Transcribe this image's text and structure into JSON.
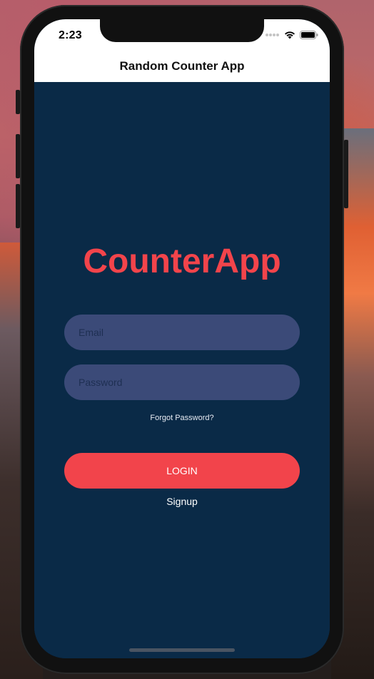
{
  "status_bar": {
    "time": "2:23",
    "icons": [
      "signal-dots-icon",
      "wifi-icon",
      "battery-icon"
    ]
  },
  "nav": {
    "title": "Random Counter App"
  },
  "login": {
    "app_title": "CounterApp",
    "email_placeholder": "Email",
    "password_placeholder": "Password",
    "forgot_label": "Forgot Password?",
    "login_label": "LOGIN",
    "signup_label": "Signup"
  },
  "colors": {
    "background": "#0a2a47",
    "accent": "#f2444b",
    "input_bg": "#3b4a78"
  }
}
